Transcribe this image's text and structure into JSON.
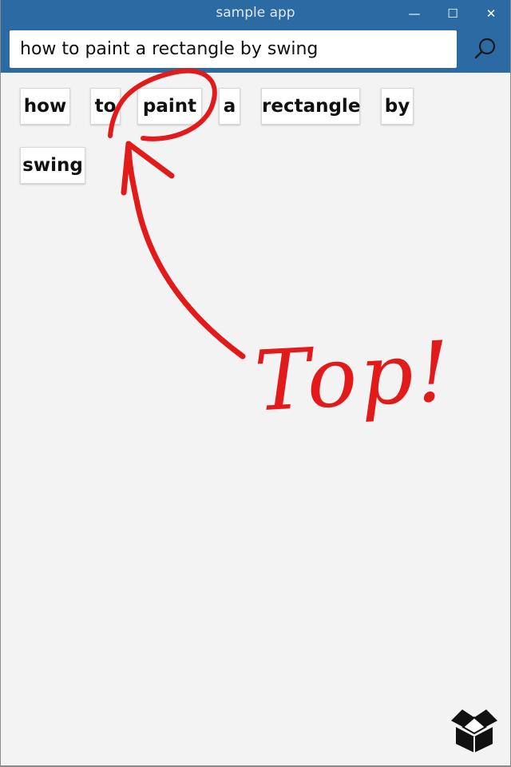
{
  "window": {
    "title": "sample app",
    "minimize_glyph": "—",
    "maximize_glyph": "☐",
    "close_glyph": "✕"
  },
  "search": {
    "value": "how to paint a rectangle by swing",
    "icon": "search-icon"
  },
  "tokens": [
    "how",
    "to",
    "paint",
    "a",
    "rectangle",
    "by",
    "swing"
  ],
  "annotation": {
    "text": "Top!",
    "color": "#e21a1a"
  },
  "footer": {
    "icon": "open-box-icon"
  },
  "colors": {
    "titlebar": "#2c6aa3",
    "background": "#f3f3f3"
  }
}
